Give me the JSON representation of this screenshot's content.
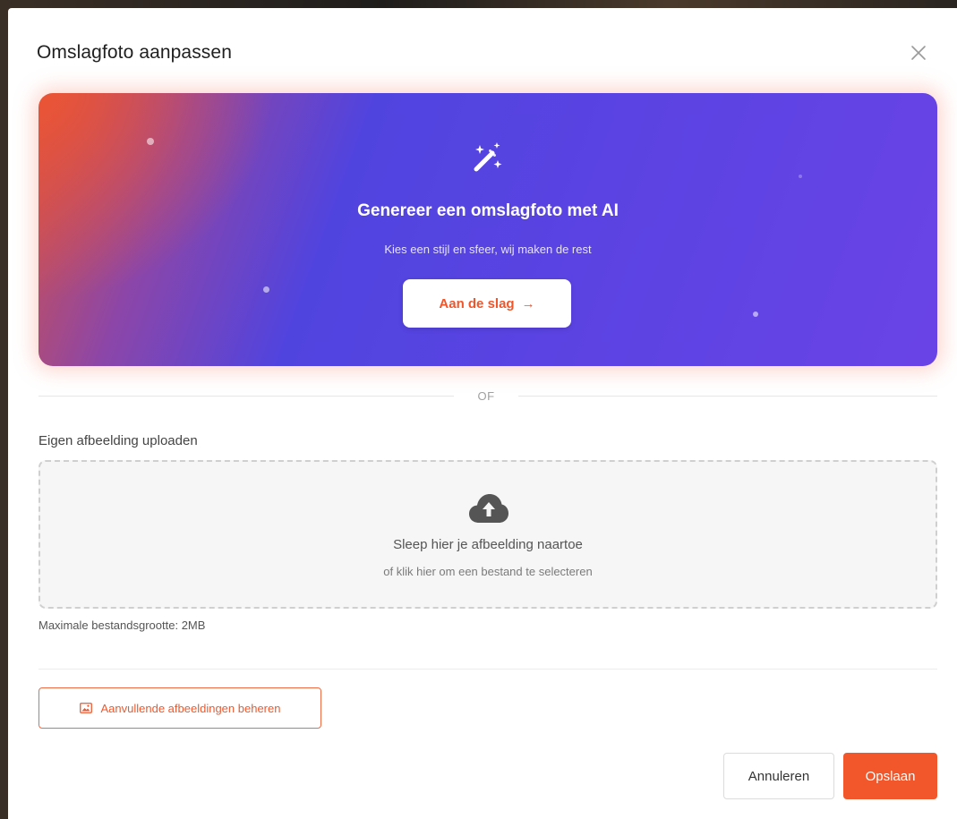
{
  "modal": {
    "title": "Omslagfoto aanpassen",
    "close_icon": "close-icon"
  },
  "ai_banner": {
    "icon": "magic-wand-icon",
    "title": "Genereer een omslagfoto met AI",
    "subtitle": "Kies een stijl en sfeer, wij maken de rest",
    "cta_label": "Aan de slag",
    "cta_arrow": "→",
    "gradient_colors": [
      "#ec5434",
      "#8c46a8",
      "#5044df",
      "#6a43e6"
    ]
  },
  "divider": {
    "label": "OF"
  },
  "upload": {
    "label": "Eigen afbeelding uploaden",
    "icon": "cloud-upload-icon",
    "drop_title": "Sleep hier je afbeelding naartoe",
    "drop_subtitle": "of klik hier om een bestand te selecteren",
    "max_size": "Maximale bestandsgrootte: 2MB"
  },
  "actions": {
    "manage_images_label": "Aanvullende afbeeldingen beheren",
    "manage_images_icon": "image-icon",
    "cancel_label": "Annuleren",
    "save_label": "Opslaan"
  },
  "colors": {
    "accent": "#f2572b",
    "banner_purple": "#5a43e2"
  }
}
